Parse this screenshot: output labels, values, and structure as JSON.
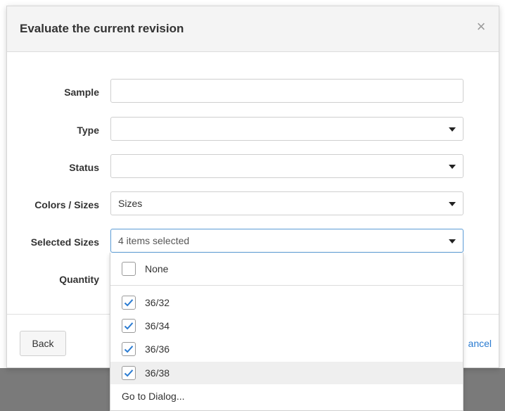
{
  "dialog": {
    "title": "Evaluate the current revision",
    "close_glyph": "×"
  },
  "fields": {
    "sample": {
      "label": "Sample",
      "value": ""
    },
    "type": {
      "label": "Type",
      "value": ""
    },
    "status": {
      "label": "Status",
      "value": ""
    },
    "colors_sizes": {
      "label": "Colors / Sizes",
      "value": "Sizes"
    },
    "selected_sizes": {
      "label": "Selected Sizes",
      "value": "4 items selected"
    },
    "quantity": {
      "label": "Quantity"
    }
  },
  "dropdown": {
    "none_option": {
      "label": "None",
      "checked": false
    },
    "options": [
      {
        "label": "36/32",
        "checked": true
      },
      {
        "label": "36/34",
        "checked": true
      },
      {
        "label": "36/36",
        "checked": true
      },
      {
        "label": "36/38",
        "checked": true,
        "highlighted": true
      }
    ],
    "goto_label": "Go to Dialog..."
  },
  "footer": {
    "back_label": "Back",
    "cancel_label": "ancel"
  },
  "colors": {
    "accent": "#2a7bd1",
    "focus_border": "#5b9bd5",
    "check": "#2a7bd1"
  }
}
